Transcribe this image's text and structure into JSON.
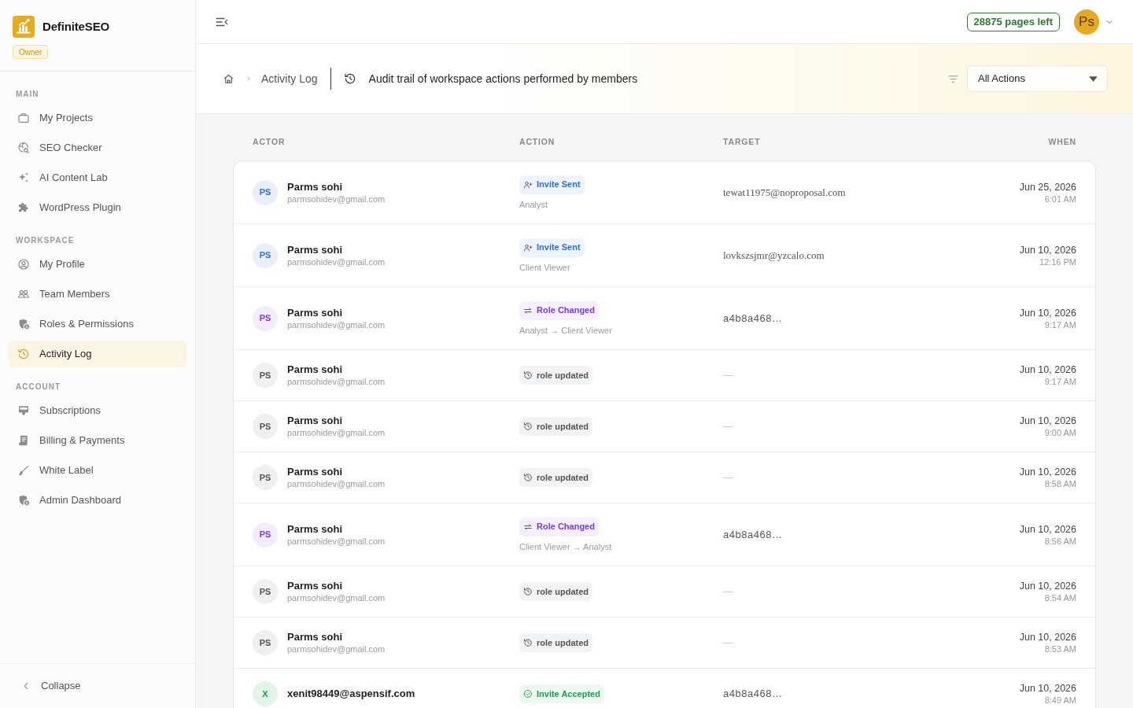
{
  "brand": {
    "name": "DefiniteSEO",
    "badge": "Owner"
  },
  "sidebar": {
    "sections": [
      {
        "title": "MAIN",
        "items": [
          {
            "label": "My Projects",
            "selected": false
          },
          {
            "label": "SEO Checker",
            "selected": false
          },
          {
            "label": "AI Content Lab",
            "selected": false
          },
          {
            "label": "WordPress Plugin",
            "selected": false
          }
        ]
      },
      {
        "title": "WORKSPACE",
        "items": [
          {
            "label": "My Profile",
            "selected": false
          },
          {
            "label": "Team Members",
            "selected": false
          },
          {
            "label": "Roles & Permissions",
            "selected": false
          },
          {
            "label": "Activity Log",
            "selected": true
          }
        ]
      },
      {
        "title": "ACCOUNT",
        "items": [
          {
            "label": "Subscriptions",
            "selected": false
          },
          {
            "label": "Billing & Payments",
            "selected": false
          },
          {
            "label": "White Label",
            "selected": false
          },
          {
            "label": "Admin Dashboard",
            "selected": false
          }
        ]
      }
    ],
    "collapse": "Collapse"
  },
  "topbar": {
    "pages_left": "28875 pages left",
    "avatar": "Ps"
  },
  "header": {
    "breadcrumb": "Activity Log",
    "description": "Audit trail of workspace actions performed by members",
    "filter": {
      "value": "All Actions"
    }
  },
  "table": {
    "columns": [
      "ACTOR",
      "ACTION",
      "TARGET",
      "WHEN"
    ],
    "rows": [
      {
        "actor": {
          "initials": "PS",
          "name": "Parms sohi",
          "email": "parmsohidev@gmail.com"
        },
        "action": {
          "kind": "invite_sent",
          "label": "Invite Sent",
          "detail": "Analyst"
        },
        "target": {
          "kind": "email",
          "text": "tewat11975@noproposal.com"
        },
        "date": "Jun 25, 2026",
        "time": "6:01 AM"
      },
      {
        "actor": {
          "initials": "PS",
          "name": "Parms sohi",
          "email": "parmsohidev@gmail.com"
        },
        "action": {
          "kind": "invite_sent",
          "label": "Invite Sent",
          "detail": "Client Viewer"
        },
        "target": {
          "kind": "email",
          "text": "lovkszsjmr@yzcalo.com"
        },
        "date": "Jun 10, 2026",
        "time": "12:16 PM"
      },
      {
        "actor": {
          "initials": "PS",
          "name": "Parms sohi",
          "email": "parmsohidev@gmail.com"
        },
        "action": {
          "kind": "role_changed",
          "label": "Role Changed",
          "detail": "Analyst → Client Viewer"
        },
        "target": {
          "kind": "id",
          "text": "a4b8a468…"
        },
        "date": "Jun 10, 2026",
        "time": "9:17 AM"
      },
      {
        "actor": {
          "initials": "PS",
          "name": "Parms sohi",
          "email": "parmsohidev@gmail.com"
        },
        "action": {
          "kind": "role_updated",
          "label": "role updated"
        },
        "target": {
          "kind": "none",
          "text": "—"
        },
        "date": "Jun 10, 2026",
        "time": "9:17 AM"
      },
      {
        "actor": {
          "initials": "PS",
          "name": "Parms sohi",
          "email": "parmsohidev@gmail.com"
        },
        "action": {
          "kind": "role_updated",
          "label": "role updated"
        },
        "target": {
          "kind": "none",
          "text": "—"
        },
        "date": "Jun 10, 2026",
        "time": "9:00 AM"
      },
      {
        "actor": {
          "initials": "PS",
          "name": "Parms sohi",
          "email": "parmsohidev@gmail.com"
        },
        "action": {
          "kind": "role_updated",
          "label": "role updated"
        },
        "target": {
          "kind": "none",
          "text": "—"
        },
        "date": "Jun 10, 2026",
        "time": "8:58 AM"
      },
      {
        "actor": {
          "initials": "PS",
          "name": "Parms sohi",
          "email": "parmsohidev@gmail.com"
        },
        "action": {
          "kind": "role_changed",
          "label": "Role Changed",
          "detail": "Client Viewer → Analyst"
        },
        "target": {
          "kind": "id",
          "text": "a4b8a468…"
        },
        "date": "Jun 10, 2026",
        "time": "8:56 AM"
      },
      {
        "actor": {
          "initials": "PS",
          "name": "Parms sohi",
          "email": "parmsohidev@gmail.com"
        },
        "action": {
          "kind": "role_updated",
          "label": "role updated"
        },
        "target": {
          "kind": "none",
          "text": "—"
        },
        "date": "Jun 10, 2026",
        "time": "8:54 AM"
      },
      {
        "actor": {
          "initials": "PS",
          "name": "Parms sohi",
          "email": "parmsohidev@gmail.com"
        },
        "action": {
          "kind": "role_updated",
          "label": "role updated"
        },
        "target": {
          "kind": "none",
          "text": "—"
        },
        "date": "Jun 10, 2026",
        "time": "8:53 AM"
      },
      {
        "actor": {
          "initials": "X",
          "name": "xenit98449@aspensif.com"
        },
        "action": {
          "kind": "invite_accepted",
          "label": "Invite Accepted"
        },
        "target": {
          "kind": "id",
          "text": "a4b8a468…"
        },
        "date": "Jun 10, 2026",
        "time": "8:49 AM"
      }
    ]
  }
}
